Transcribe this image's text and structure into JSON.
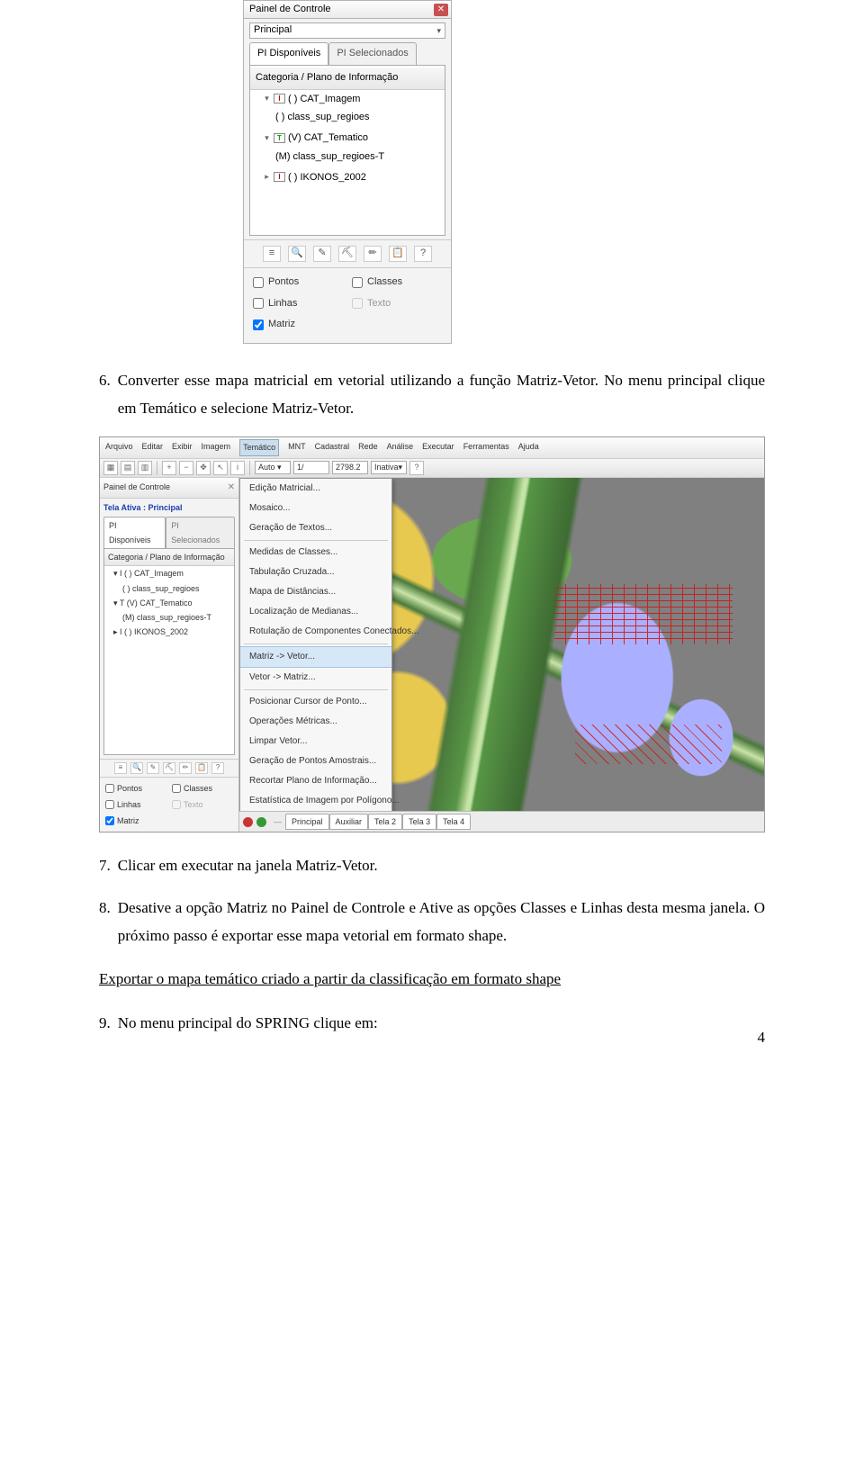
{
  "panel1": {
    "title": "Painel de Controle",
    "combo": "Principal",
    "tabs": [
      "PI Disponíveis",
      "PI Selecionados"
    ],
    "treeHeader": "Categoria / Plano de Informação",
    "tree": [
      {
        "tw": "▾",
        "badge": "I",
        "label": "( ) CAT_Imagem"
      },
      {
        "indent": 1,
        "label": "( ) class_sup_regioes"
      },
      {
        "tw": "▾",
        "badge": "T",
        "label": "(V) CAT_Tematico"
      },
      {
        "indent": 1,
        "label": "(M) class_sup_regioes-T"
      },
      {
        "tw": "▸",
        "badge": "I",
        "label": "( ) IKONOS_2002"
      }
    ],
    "toolIcons": [
      "≡",
      "🔍",
      "✎",
      "⛏",
      "✏",
      "📋",
      "?"
    ],
    "checks": [
      {
        "key": "pontos",
        "label": "Pontos",
        "checked": false,
        "disabled": false
      },
      {
        "key": "classes",
        "label": "Classes",
        "checked": false,
        "disabled": false
      },
      {
        "key": "linhas",
        "label": "Linhas",
        "checked": false,
        "disabled": false
      },
      {
        "key": "texto",
        "label": "Texto",
        "checked": false,
        "disabled": true
      },
      {
        "key": "matriz",
        "label": "Matriz",
        "checked": true,
        "disabled": false
      }
    ]
  },
  "para6": {
    "num": "6.",
    "text": "Converter esse mapa matricial em vetorial utilizando a função Matriz-Vetor. No menu principal clique em Temático e selecione Matriz-Vetor."
  },
  "shot": {
    "menus": [
      "Arquivo",
      "Editar",
      "Exibir",
      "Imagem",
      "Temático",
      "MNT",
      "Cadastral",
      "Rede",
      "Análise",
      "Executar",
      "Ferramentas",
      "Ajuda"
    ],
    "scaleLabel": "1/",
    "scaleValue": "2798.2",
    "inativa": "Inativa",
    "leftPanel": {
      "title": "Painel de Controle",
      "telaAtiva": "Tela Ativa : Principal",
      "tabs": [
        "PI Disponíveis",
        "PI Selecionados"
      ],
      "treeHeader": "Categoria / Plano de Informação",
      "tree": [
        "▾ I  ( ) CAT_Imagem",
        "      ( ) class_sup_regioes",
        "▾ T  (V) CAT_Tematico",
        "      (M) class_sup_regioes-T",
        "▸ I  ( ) IKONOS_2002"
      ],
      "checks": [
        {
          "label": "Pontos",
          "checked": false,
          "disabled": false
        },
        {
          "label": "Classes",
          "checked": false,
          "disabled": false
        },
        {
          "label": "Linhas",
          "checked": false,
          "disabled": false
        },
        {
          "label": "Texto",
          "checked": false,
          "disabled": true
        },
        {
          "label": "Matriz",
          "checked": true,
          "disabled": false
        }
      ]
    },
    "dropdown": [
      "Edição Matricial...",
      "Mosaico...",
      "Geração de Textos...",
      "---",
      "Medidas de Classes...",
      "Tabulação Cruzada...",
      "Mapa de Distâncias...",
      "Localização de Medianas...",
      "Rotulação de Componentes Conectados...",
      "---",
      "Matriz -> Vetor...",
      "Vetor -> Matriz...",
      "---",
      "Posicionar Cursor de Ponto...",
      "Operações Métricas...",
      "Limpar Vetor...",
      "Geração de Pontos Amostrais...",
      "Recortar Plano de Informação...",
      "Estatística de Imagem por Polígono..."
    ],
    "dropdownSelected": "Matriz -> Vetor...",
    "bottomTabs": [
      "Principal",
      "Auxiliar",
      "Tela 2",
      "Tela 3",
      "Tela 4"
    ]
  },
  "para7": {
    "num": "7.",
    "text": "Clicar em executar na janela Matriz-Vetor."
  },
  "para8": {
    "num": "8.",
    "text": "Desative a opção Matriz no Painel de Controle e Ative as opções Classes e Linhas desta mesma janela. O próximo passo é exportar esse mapa vetorial em formato shape."
  },
  "heading": "Exportar o mapa temático criado a partir da classificação em formato shape",
  "para9": {
    "num": "9.",
    "text": "No menu principal do SPRING clique em:"
  },
  "pageNumber": "4"
}
